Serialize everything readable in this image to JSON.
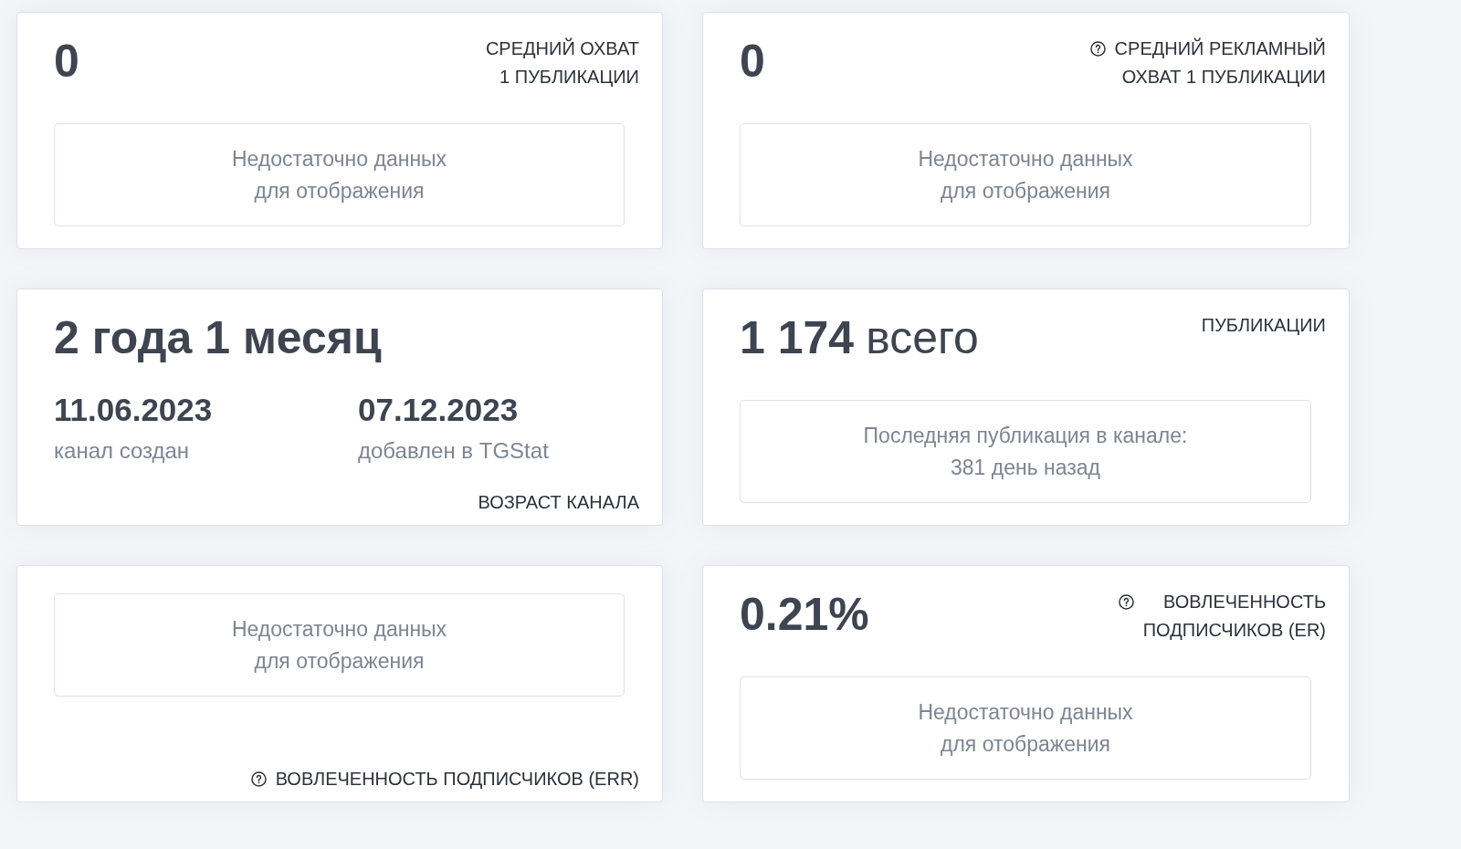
{
  "rows": [
    {
      "cards": [
        {
          "kind": "metric",
          "value": "0",
          "title": "СРЕДНИЙ ОХВАТ\n1 ПУБЛИКАЦИИ",
          "help": false,
          "message": "Недостаточно данных\nдля отображения"
        },
        {
          "kind": "metric",
          "value": "0",
          "title": "СРЕДНИЙ РЕКЛАМНЫЙ\nОХВАТ 1 ПУБЛИКАЦИИ",
          "help": true,
          "message": "Недостаточно данных\nдля отображения"
        }
      ]
    },
    {
      "cards": [
        {
          "kind": "age",
          "value": "2 года 1 месяц",
          "dates": [
            {
              "date": "11.06.2023",
              "caption": "канал создан"
            },
            {
              "date": "07.12.2023",
              "caption": "добавлен в TGStat"
            }
          ],
          "title": "ВОЗРАСТ КАНАЛА",
          "help": false
        },
        {
          "kind": "metric",
          "value": "1 174",
          "unit": "всего",
          "title": "ПУБЛИКАЦИИ",
          "help": false,
          "message": "Последняя публикация в канале:\n381 день назад"
        }
      ]
    },
    {
      "cards": [
        {
          "kind": "empty",
          "message": "Недостаточно данных\nдля отображения",
          "title": "ВОВЛЕЧЕННОСТЬ ПОДПИСЧИКОВ (ERR)",
          "help": true
        },
        {
          "kind": "metric",
          "value": "0.21%",
          "title": "ВОВЛЕЧЕННОСТЬ\nПОДПИСЧИКОВ (ER)",
          "help": true,
          "message": "Недостаточно данных\nдля отображения"
        }
      ]
    }
  ]
}
